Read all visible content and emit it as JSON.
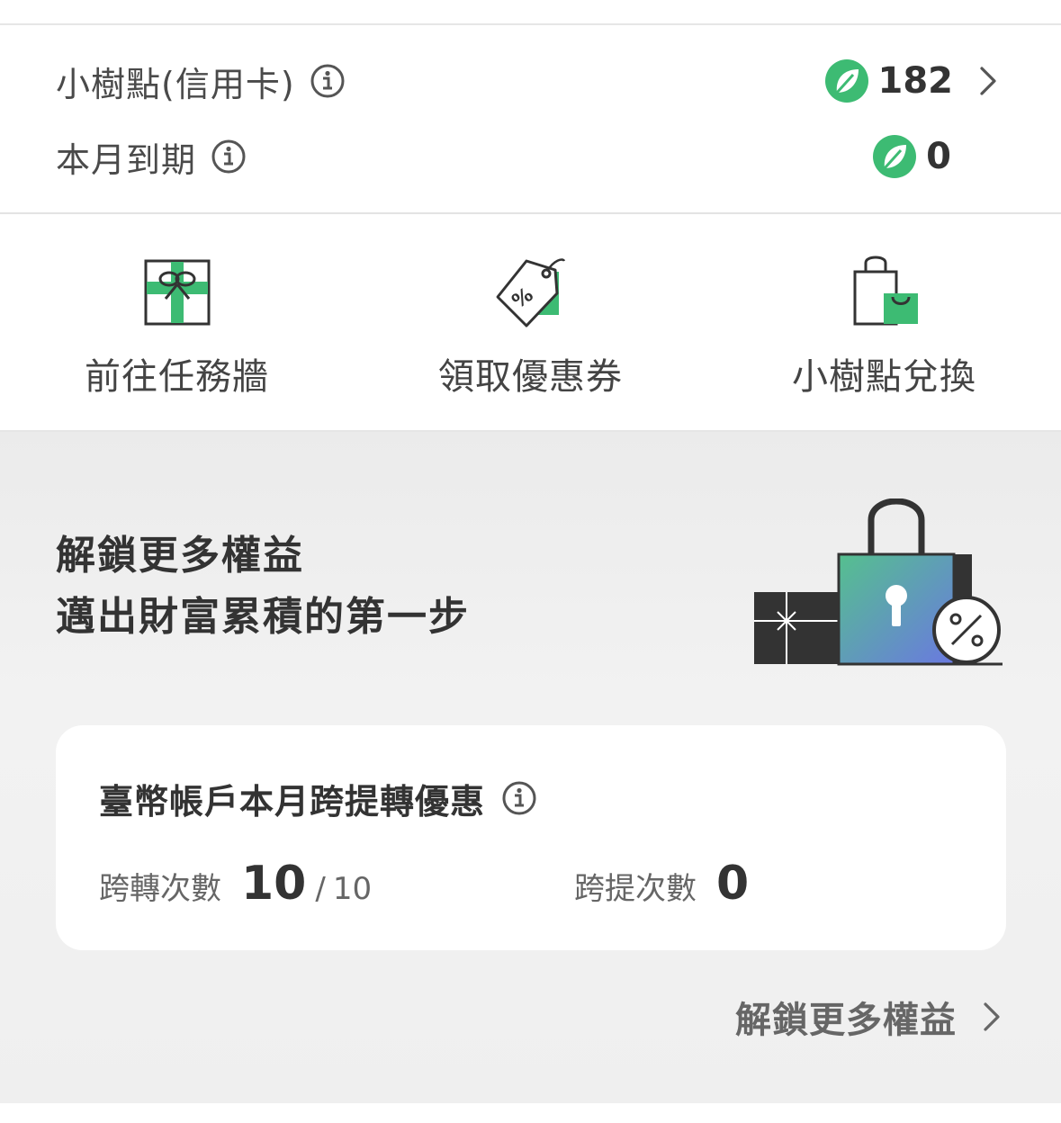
{
  "points": {
    "balance_label": "小樹點(信用卡)",
    "balance_value": "182",
    "expiring_label": "本月到期",
    "expiring_value": "0"
  },
  "actions": [
    {
      "label": "前往任務牆",
      "icon": "gift-icon"
    },
    {
      "label": "領取優惠券",
      "icon": "coupon-tag-icon"
    },
    {
      "label": "小樹點兌換",
      "icon": "shopping-bag-icon"
    }
  ],
  "benefits": {
    "headline_line1": "解鎖更多權益",
    "headline_line2": "邁出財富累積的第一步",
    "card_title": "臺幣帳戶本月跨提轉優惠",
    "transfer_label": "跨轉次數",
    "transfer_value": "10",
    "transfer_separator": "/",
    "transfer_total": "10",
    "withdraw_label": "跨提次數",
    "withdraw_value": "0",
    "more_link": "解鎖更多權益"
  },
  "colors": {
    "accent_green": "#3dbb73",
    "dark": "#333333"
  }
}
